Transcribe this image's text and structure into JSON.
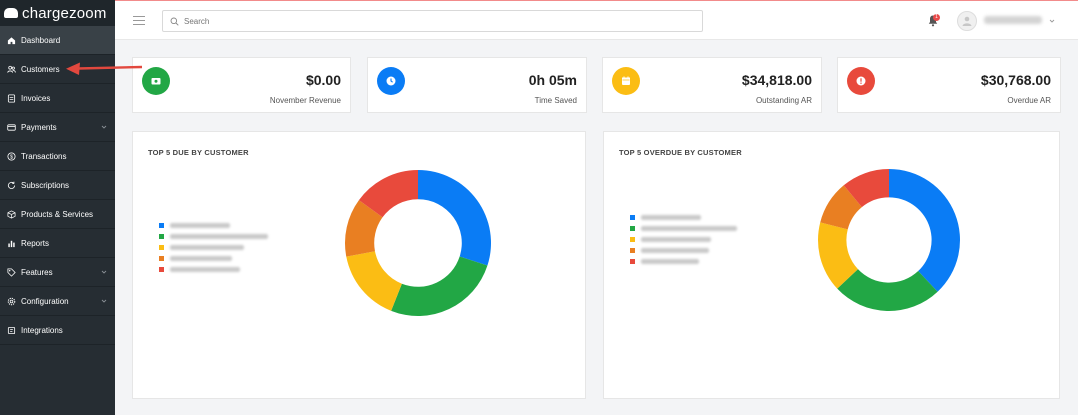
{
  "app": {
    "brand": "chargezoom"
  },
  "colors": {
    "blue": "#0a7cf5",
    "green": "#22a745",
    "yellow": "#fbbd14",
    "orange": "#e97f22",
    "red": "#e84a3c",
    "accent_red": "#e84a4a"
  },
  "sidebar": {
    "items": [
      {
        "label": "Dashboard",
        "icon": "home-icon",
        "active": true
      },
      {
        "label": "Customers",
        "icon": "users-icon"
      },
      {
        "label": "Invoices",
        "icon": "invoice-icon"
      },
      {
        "label": "Payments",
        "icon": "credit-card-icon",
        "has_submenu": true
      },
      {
        "label": "Transactions",
        "icon": "dollar-circle-icon"
      },
      {
        "label": "Subscriptions",
        "icon": "refresh-icon"
      },
      {
        "label": "Products & Services",
        "icon": "box-icon"
      },
      {
        "label": "Reports",
        "icon": "bar-chart-icon"
      },
      {
        "label": "Features",
        "icon": "tag-icon",
        "has_submenu": true
      },
      {
        "label": "Configuration",
        "icon": "gear-icon",
        "has_submenu": true
      },
      {
        "label": "Integrations",
        "icon": "puzzle-icon"
      }
    ]
  },
  "topbar": {
    "search_placeholder": "Search",
    "notifications_count": "1"
  },
  "stats": [
    {
      "value": "$0.00",
      "label": "November Revenue",
      "icon": "wallet-icon",
      "color": "#22a745"
    },
    {
      "value": "0h 05m",
      "label": "Time Saved",
      "icon": "clock-icon",
      "color": "#0a7cf5"
    },
    {
      "value": "$34,818.00",
      "label": "Outstanding AR",
      "icon": "calendar-icon",
      "color": "#fbbd14"
    },
    {
      "value": "$30,768.00",
      "label": "Overdue AR",
      "icon": "alert-icon",
      "color": "#e84a3c"
    }
  ],
  "panels": [
    {
      "title": "TOP 5 DUE BY CUSTOMER"
    },
    {
      "title": "TOP 5 OVERDUE BY CUSTOMER"
    }
  ],
  "chart_data": [
    {
      "type": "pie",
      "title": "TOP 5 DUE BY CUSTOMER",
      "donut": true,
      "legend": "left",
      "series_colors": [
        "#0a7cf5",
        "#22a745",
        "#fbbd14",
        "#e97f22",
        "#e84a3c"
      ],
      "values": [
        30,
        26,
        16,
        13,
        15
      ]
    },
    {
      "type": "pie",
      "title": "TOP 5 OVERDUE BY CUSTOMER",
      "donut": true,
      "legend": "left",
      "series_colors": [
        "#0a7cf5",
        "#22a745",
        "#fbbd14",
        "#e97f22",
        "#e84a3c"
      ],
      "values": [
        38,
        25,
        16,
        10,
        11
      ]
    }
  ]
}
